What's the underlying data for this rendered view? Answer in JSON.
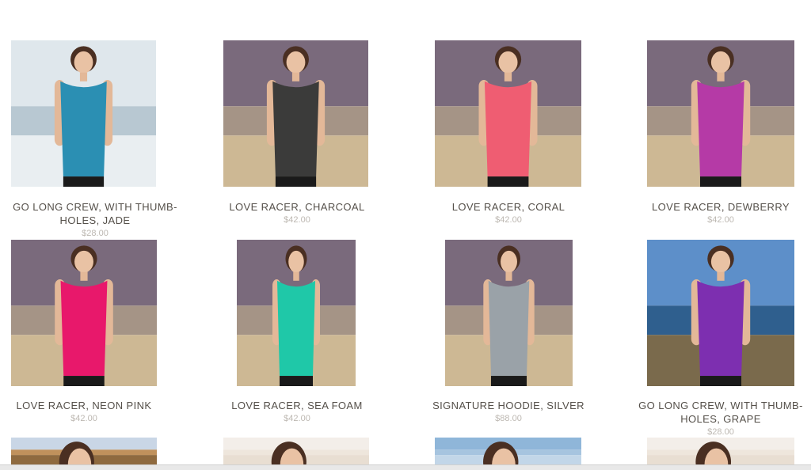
{
  "products": [
    {
      "name": "GO LONG CREW, WITH THUMB-HOLES, JADE",
      "price": "$28.00",
      "shirt": "#2b8fb3",
      "bg": "sea"
    },
    {
      "name": "LOVE RACER, CHARCOAL",
      "price": "$42.00",
      "shirt": "#3b3b3a",
      "bg": "field"
    },
    {
      "name": "LOVE RACER, CORAL",
      "price": "$42.00",
      "shirt": "#ef5d72",
      "bg": "field"
    },
    {
      "name": "LOVE RACER, DEWBERRY",
      "price": "$42.00",
      "shirt": "#b53aa6",
      "bg": "field"
    },
    {
      "name": "LOVE RACER, NEON PINK",
      "price": "$42.00",
      "shirt": "#e8186b",
      "bg": "field"
    },
    {
      "name": "LOVE RACER, SEA FOAM",
      "price": "$42.00",
      "shirt": "#1fc8a8",
      "bg": "field"
    },
    {
      "name": "SIGNATURE HOODIE, SILVER",
      "price": "$88.00",
      "shirt": "#9aa2a8",
      "bg": "field"
    },
    {
      "name": "GO LONG CREW, WITH THUMB-HOLES, GRAPE",
      "price": "$28.00",
      "shirt": "#7d2fb0",
      "bg": "beach"
    }
  ],
  "partial_row": [
    {
      "bg": "dusk"
    },
    {
      "bg": "light"
    },
    {
      "bg": "sky"
    },
    {
      "bg": "light"
    }
  ]
}
